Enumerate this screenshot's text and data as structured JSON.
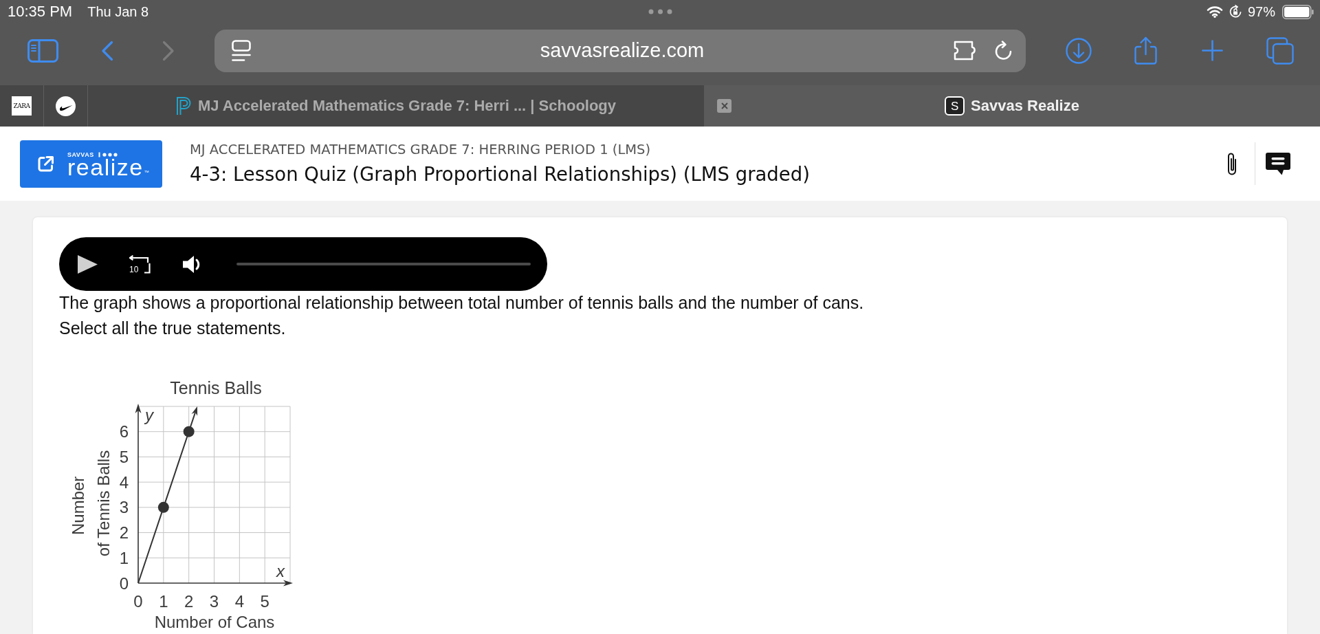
{
  "status_bar": {
    "time": "10:35 PM",
    "date": "Thu Jan 8",
    "battery": "97%"
  },
  "browser_toolbar": {
    "nav_buttons": [
      {
        "kind": "back",
        "disabled": false
      },
      {
        "kind": "forward",
        "disabled": true
      }
    ],
    "address": "savvasrealize.com"
  },
  "tabs": [
    {
      "kind": "pinned",
      "favicon": {
        "kind": "text",
        "text": "ZARA"
      },
      "selected": false
    },
    {
      "kind": "pinned",
      "favicon": {
        "kind": "swoosh"
      },
      "selected": false
    },
    {
      "kind": "page",
      "favicon": {
        "kind": "logo"
      },
      "title": "MJ Accelerated Mathematics Grade 7: Herri ... | Schoology",
      "selected": false
    },
    {
      "kind": "page",
      "favicon": {
        "kind": "letter",
        "text": "S"
      },
      "title": "Savvas Realize",
      "selected": true
    }
  ],
  "header": {
    "logo": {
      "brand": "SAVVAS",
      "name": "realize",
      "mark": "™"
    },
    "course": "MJ ACCELERATED MATHEMATICS GRADE 7: HERRING PERIOD 1 (LMS)",
    "title": "4-3: Lesson Quiz (Graph Proportional Relationships) (LMS graded)"
  },
  "audio_player": {
    "replay_label": "10"
  },
  "question": {
    "prompt": "The graph shows a proportional relationship between total number of tennis balls and the number of cans.",
    "instruction": "Select all the true statements."
  },
  "graph": {
    "x_letter": "x",
    "y_letter": "y",
    "chart_data": {
      "type": "line",
      "title": "Tennis Balls",
      "xlabel": "Number of Cans",
      "ylabel": "Number of Tennis Balls",
      "x": [
        0,
        1,
        2
      ],
      "series": [
        {
          "color": "#333333",
          "values": [
            0,
            3,
            6
          ]
        }
      ],
      "xlim": [
        0,
        6
      ],
      "ylim": [
        0,
        7
      ],
      "xticks": [
        0,
        1,
        2,
        3,
        4,
        5
      ],
      "yticks": [
        0,
        1,
        2,
        3,
        4,
        5,
        6
      ],
      "grid": true
    }
  }
}
